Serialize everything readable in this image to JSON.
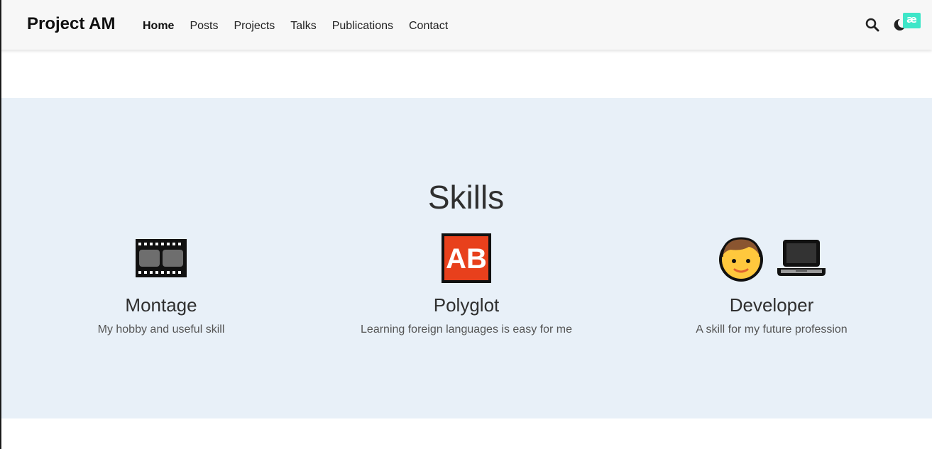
{
  "navbar": {
    "brand": "Project AM",
    "links": [
      {
        "label": "Home",
        "active": true
      },
      {
        "label": "Posts",
        "active": false
      },
      {
        "label": "Projects",
        "active": false
      },
      {
        "label": "Talks",
        "active": false
      },
      {
        "label": "Publications",
        "active": false
      },
      {
        "label": "Contact",
        "active": false
      }
    ],
    "icons": [
      "search-icon",
      "moon-icon"
    ],
    "badge": "æ"
  },
  "skills": {
    "title": "Skills",
    "items": [
      {
        "name": "Montage",
        "description": "My hobby and useful skill",
        "icon": "film-frames-icon"
      },
      {
        "name": "Polyglot",
        "description": "Learning foreign languages is easy for me",
        "icon": "ab-button-icon"
      },
      {
        "name": "Developer",
        "description": "A skill for my future profession",
        "icon": "developer-icon"
      }
    ]
  },
  "colors": {
    "navbar_bg": "#f7f7f7",
    "section_bg": "#e8f0f8",
    "badge_bg": "#3ee6c8",
    "ab_red": "#e8401c"
  }
}
